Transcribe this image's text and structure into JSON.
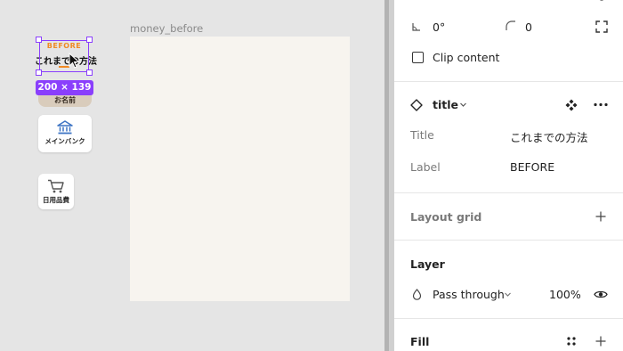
{
  "canvas": {
    "frame_label": "money_before",
    "selected_component": {
      "badge_text": "BEFORE",
      "title_text": "これまでの方法",
      "size_badge": "200 × 139",
      "name_tag": "お名前"
    },
    "cards": [
      {
        "label": "メインバンク",
        "icon": "bank-icon"
      },
      {
        "label": "日用品費",
        "icon": "shopping-cart-icon"
      }
    ]
  },
  "panel": {
    "rotation": "0°",
    "corner_radius": "0",
    "clip_content_label": "Clip content",
    "component": {
      "name": "title",
      "props": [
        {
          "label": "Title",
          "value": "これまでの方法"
        },
        {
          "label": "Label",
          "value": "BEFORE"
        }
      ]
    },
    "layout_grid_label": "Layout grid",
    "layer": {
      "heading": "Layer",
      "blend_mode": "Pass through",
      "opacity": "100%"
    },
    "fill_heading": "Fill"
  },
  "colors": {
    "selection": "#8a3ffc",
    "before_orange": "#f08a24",
    "frame_bg": "#f7f4ef",
    "bank_blue": "#3d74c4"
  }
}
